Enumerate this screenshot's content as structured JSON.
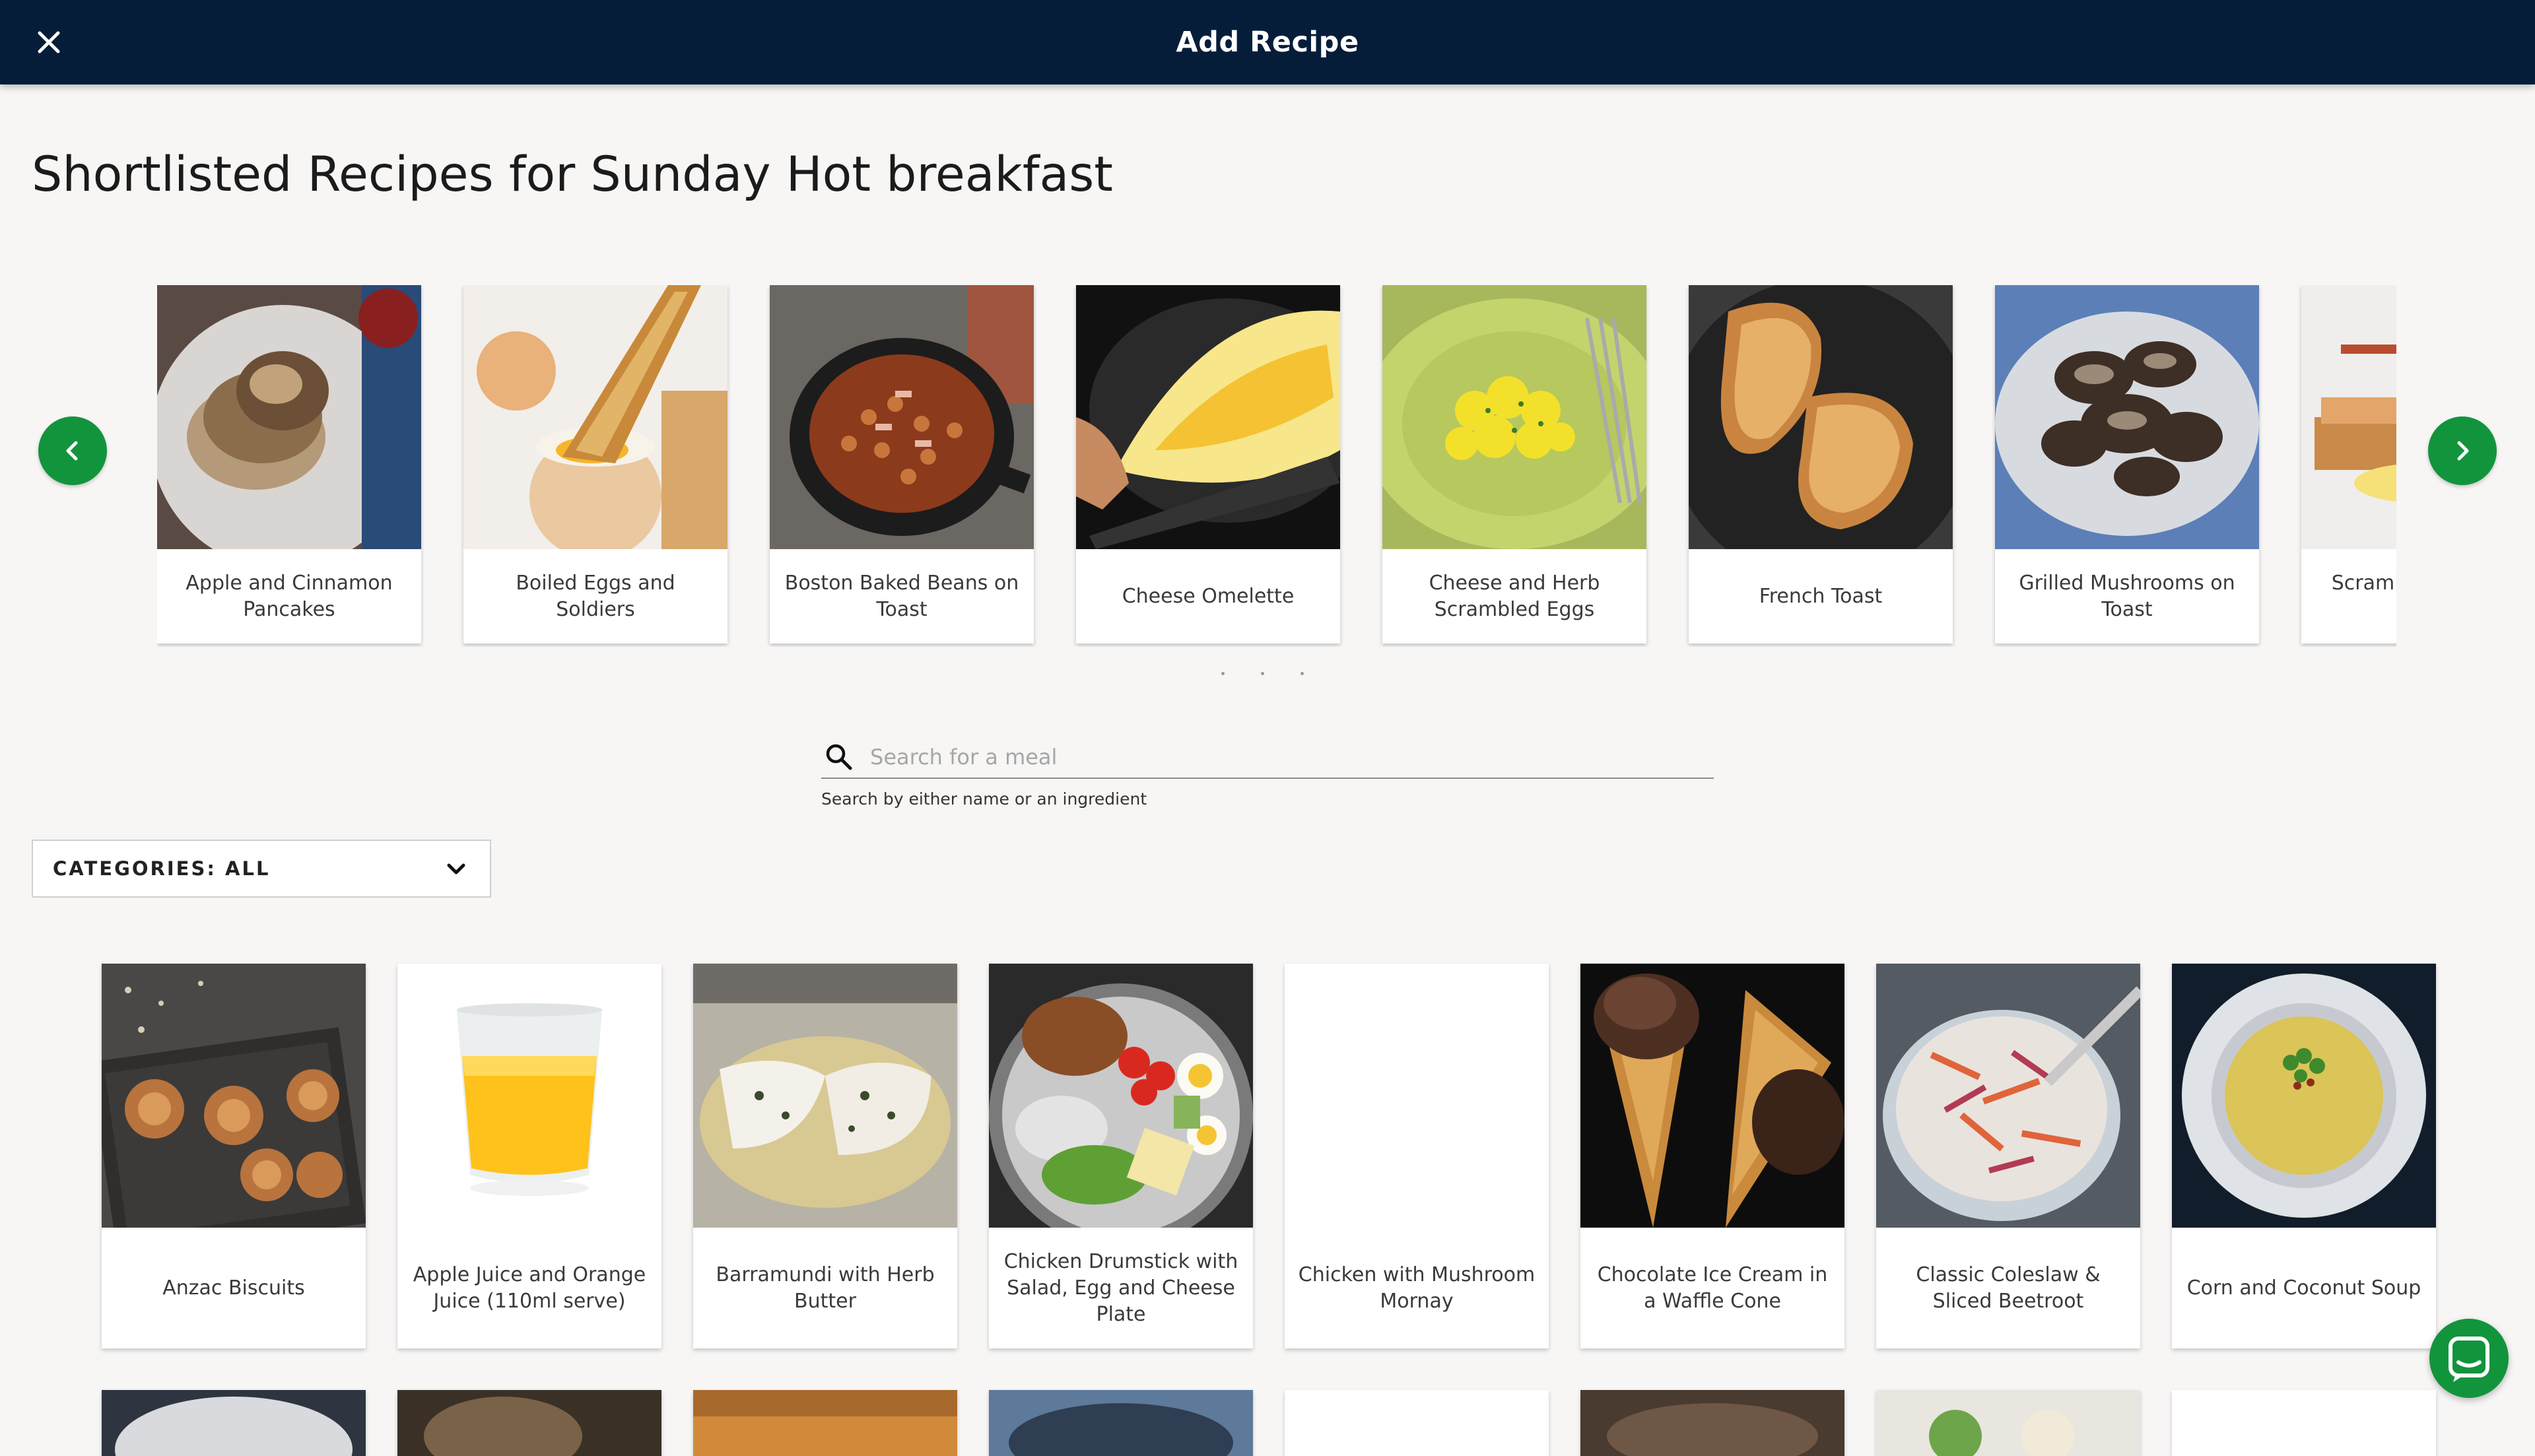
{
  "topbar": {
    "title": "Add Recipe",
    "close_icon": "close-icon"
  },
  "page": {
    "title": "Shortlisted Recipes for Sunday Hot breakfast"
  },
  "carousel": {
    "prev_icon": "chevron-left-icon",
    "next_icon": "chevron-right-icon",
    "items": [
      {
        "label": "Apple and Cinnamon Pancakes"
      },
      {
        "label": "Boiled Eggs and Soldiers"
      },
      {
        "label": "Boston Baked Beans on Toast"
      },
      {
        "label": "Cheese Omelette"
      },
      {
        "label": "Cheese and Herb Scrambled Eggs"
      },
      {
        "label": "French Toast"
      },
      {
        "label": "Grilled Mushrooms on Toast"
      },
      {
        "label": "Scrambled Eggs and Bacon"
      }
    ],
    "page_count": 3
  },
  "search": {
    "placeholder": "Search for a meal",
    "value": "",
    "helper": "Search by either name or an ingredient"
  },
  "categories": {
    "label": "CATEGORIES: ALL"
  },
  "recipes": [
    {
      "label": "Anzac Biscuits"
    },
    {
      "label": "Apple Juice and Orange Juice (110ml serve)"
    },
    {
      "label": "Barramundi with Herb Butter"
    },
    {
      "label": "Chicken Drumstick with Salad, Egg and Cheese Plate"
    },
    {
      "label": "Chicken with Mushroom Mornay"
    },
    {
      "label": "Chocolate Ice Cream in a Waffle Cone"
    },
    {
      "label": "Classic Coleslaw & Sliced Beetroot"
    },
    {
      "label": "Corn and Coconut Soup"
    }
  ],
  "chat": {
    "icon": "chat-icon"
  },
  "colors": {
    "header": "#061d3a",
    "accent": "#12943c",
    "background": "#f7f6f5"
  }
}
